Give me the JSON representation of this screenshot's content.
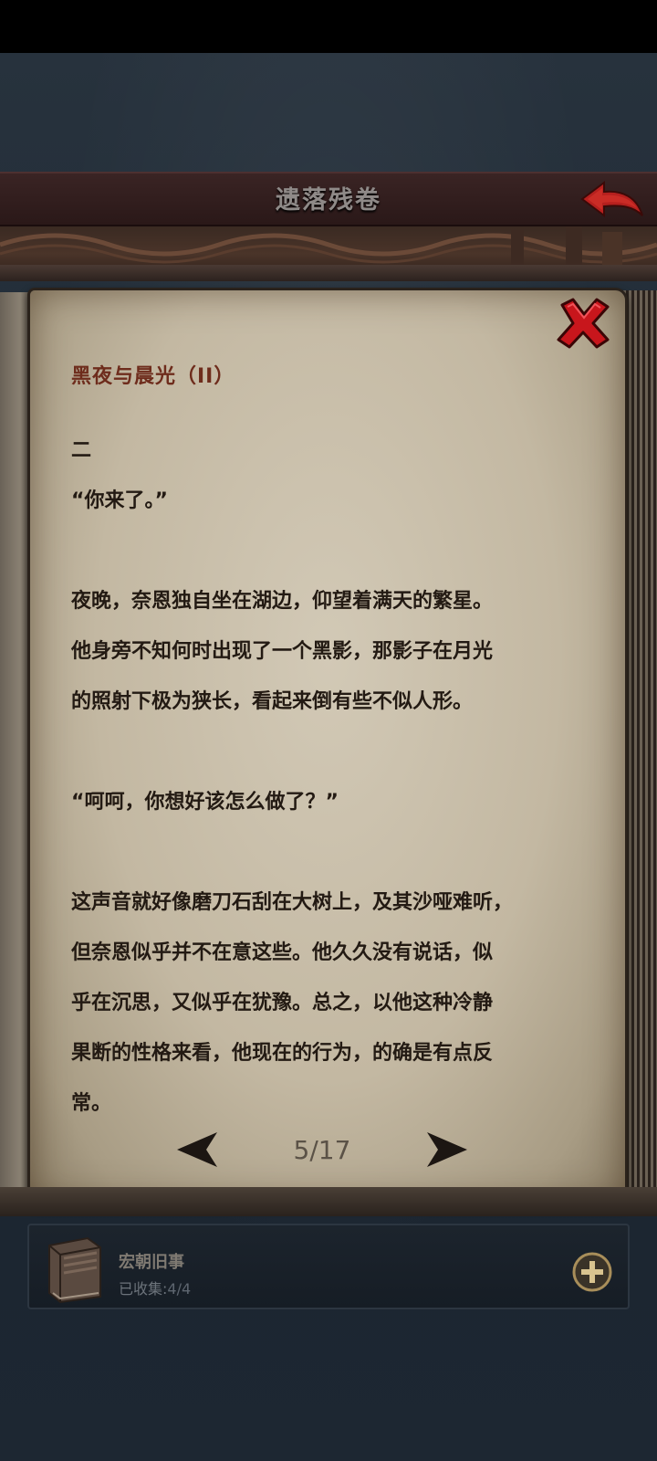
{
  "header": {
    "title": "遗落残卷"
  },
  "book": {
    "title": "黑夜与晨光（II）",
    "paragraphs": [
      "二",
      "“你来了。”",
      "",
      "夜晚，奈恩独自坐在湖边，仰望着满天的繁星。",
      "他身旁不知何时出现了一个黑影，那影子在月光",
      "的照射下极为狭长，看起来倒有些不似人形。",
      "",
      "“呵呵，你想好该怎么做了？”",
      "",
      "这声音就好像磨刀石刮在大树上，及其沙哑难听，",
      "但奈恩似乎并不在意这些。他久久没有说话，似",
      "乎在沉思，又似乎在犹豫。总之，以他这种冷静",
      "果断的性格来看，他现在的行为，的确是有点反",
      "常。"
    ],
    "page_indicator": "5/17"
  },
  "collection": {
    "name": "宏朝旧事",
    "progress_label": "已收集:",
    "progress_value": "4/4"
  },
  "icons": {
    "back": "back-arrow-icon",
    "close": "close-x-icon",
    "prev": "prev-page-arrow-icon",
    "next": "next-page-arrow-icon",
    "book": "book-icon",
    "add": "plus-circle-icon"
  },
  "colors": {
    "title_accent": "#6e2c1c",
    "close_red": "#c8161c",
    "back_red": "#b5201e"
  }
}
